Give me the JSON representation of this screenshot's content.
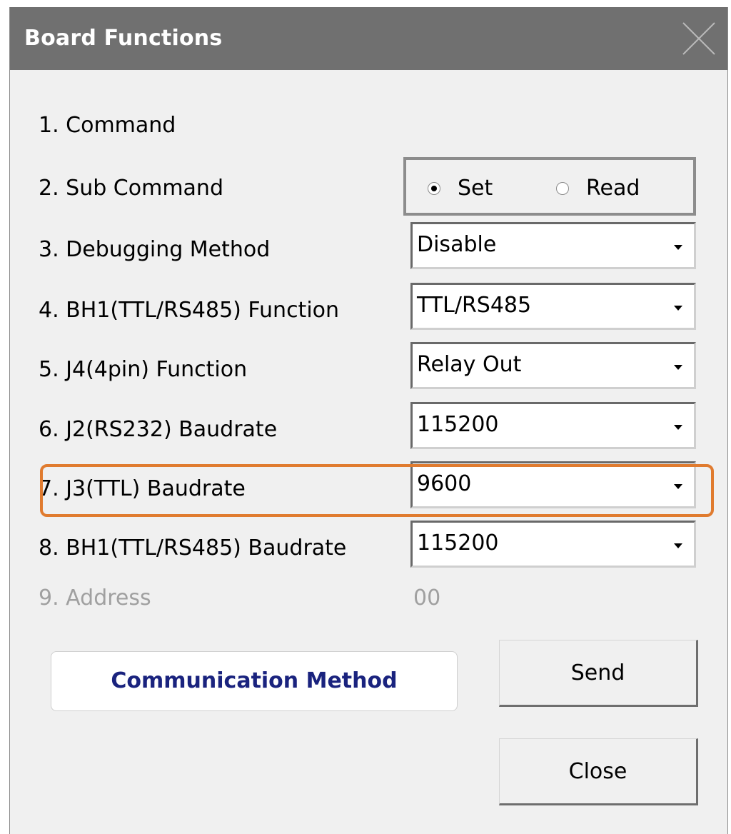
{
  "window": {
    "title": "Board Functions"
  },
  "rows": [
    {
      "label": "1. Command"
    },
    {
      "label": "2. Sub Command"
    },
    {
      "label": "3. Debugging Method",
      "value": "Disable"
    },
    {
      "label": "4. BH1(TTL/RS485) Function",
      "value": "TTL/RS485"
    },
    {
      "label": "5. J4(4pin) Function",
      "value": "Relay Out"
    },
    {
      "label": "6. J2(RS232) Baudrate",
      "value": "115200"
    },
    {
      "label": "7. J3(TTL) Baudrate",
      "value": "9600"
    },
    {
      "label": "8. BH1(TTL/RS485) Baudrate",
      "value": "115200"
    },
    {
      "label": "9. Address",
      "value": "00"
    }
  ],
  "sub_command": {
    "options": [
      "Set",
      "Read"
    ],
    "selected": "Set"
  },
  "buttons": {
    "communication_method": "Communication Method",
    "send": "Send",
    "close": "Close"
  },
  "colors": {
    "titlebar": "#707070",
    "highlight": "#e07b2f",
    "comm_button_text": "#1a237e",
    "disabled_text": "#a0a0a0"
  }
}
